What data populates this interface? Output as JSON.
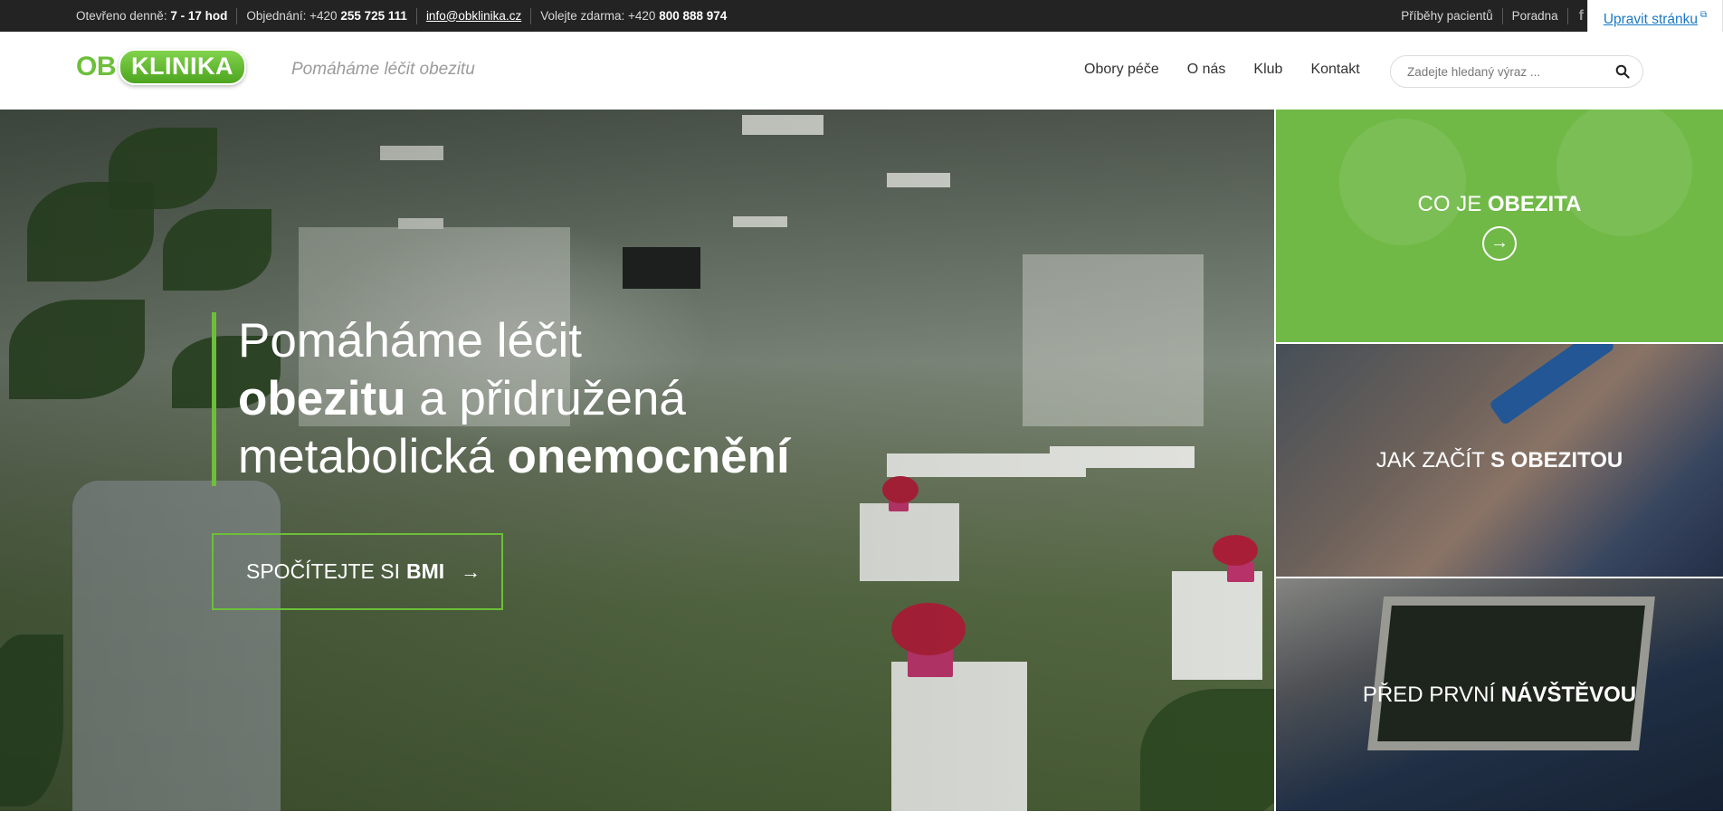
{
  "topbar": {
    "hours_label": "Otevřeno denně:",
    "hours_value": "7 - 17 hod",
    "order_label": "Objednání: +420",
    "order_phone": "255 725 111",
    "email": "info@obklinika.cz",
    "free_label": "Volejte zdarma: +420",
    "free_phone": "800 888 974",
    "links": [
      "Příběhy pacientů",
      "Poradna"
    ],
    "facebook_glyph": "f",
    "edit_link": "Upravit stránku",
    "edit_icon": "external-link-icon"
  },
  "header": {
    "logo_ob": "OB",
    "logo_klinika": "KLINIKA",
    "tagline": "Pomáháme léčit obezitu",
    "nav": [
      "Obory péče",
      "O nás",
      "Klub",
      "Kontakt"
    ],
    "search_placeholder": "Zadejte hledaný výraz ...",
    "search_icon": "search-icon"
  },
  "hero": {
    "line1": "Pomáháme léčit",
    "line2_bold": "obezitu",
    "line2_rest": " a přidružená",
    "line3_rest": "metabolická ",
    "line3_bold": "onemocnění",
    "cta_text": "SPOČÍTEJTE SI",
    "cta_bold": "BMI",
    "cta_arrow": "→"
  },
  "tiles": [
    {
      "text": "CO JE ",
      "bold": "OBEZITA",
      "arrow": "→"
    },
    {
      "text": "JAK ZAČÍT ",
      "bold": "S OBEZITOU"
    },
    {
      "text": "PŘED PRVNÍ ",
      "bold": "NÁVŠTĚVOU"
    }
  ],
  "colors": {
    "brand_green": "#6dbf3a",
    "topbar_bg": "#232323",
    "link_blue": "#1a79c7"
  }
}
